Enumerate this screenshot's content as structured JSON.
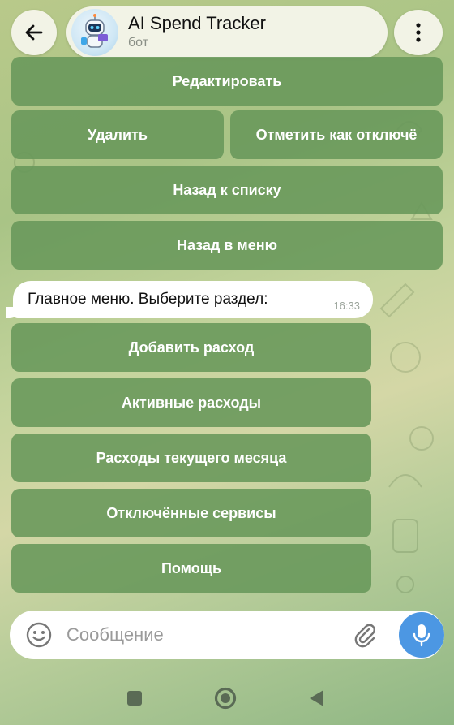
{
  "header": {
    "title": "AI Spend Tracker",
    "subtitle": "бот",
    "icons": {
      "back": "arrow-left-icon",
      "menu": "more-vertical-icon",
      "avatar": "robot-avatar"
    }
  },
  "top_keyboard": {
    "edit": "Редактировать",
    "delete": "Удалить",
    "mark_disabled": "Отметить как отключё",
    "back_to_list": "Назад к списку",
    "back_to_menu": "Назад в меню"
  },
  "message": {
    "text": "Главное меню. Выберите раздел:",
    "time": "16:33"
  },
  "menu_keyboard": {
    "add_expense": "Добавить расход",
    "active_expenses": "Активные расходы",
    "month_expenses": "Расходы текущего месяца",
    "disabled_services": "Отключённые сервисы",
    "help": "Помощь"
  },
  "composer": {
    "placeholder": "Сообщение",
    "icons": {
      "emoji": "emoji-icon",
      "attach": "paperclip-icon",
      "mic": "microphone-icon"
    }
  },
  "navbar": {
    "icons": {
      "recents": "square-icon",
      "home": "circle-icon",
      "back": "triangle-back-icon"
    }
  },
  "colors": {
    "button_bg": "#68975a",
    "accent": "#4c97e3"
  }
}
